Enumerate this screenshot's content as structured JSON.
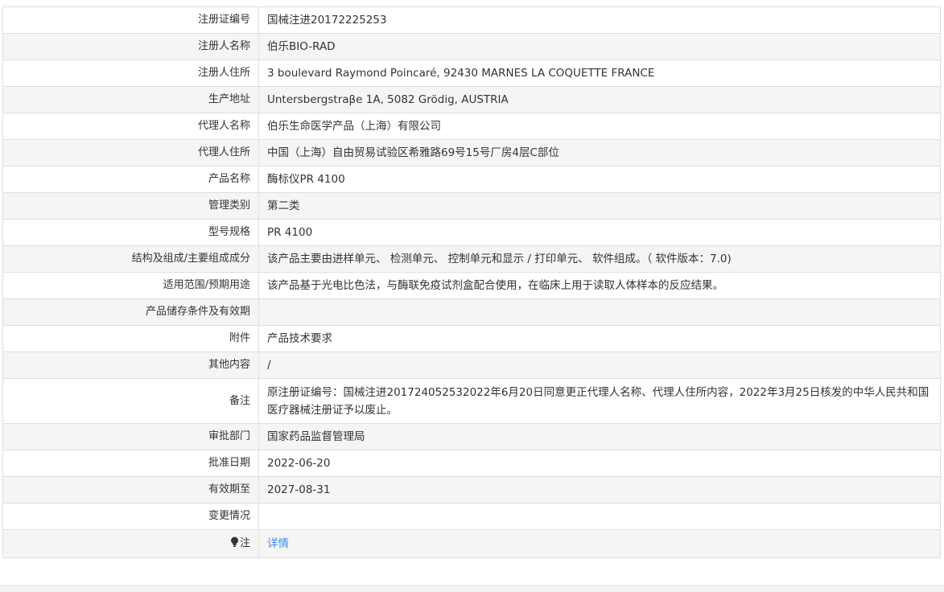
{
  "rows": [
    {
      "label": "注册证编号",
      "value": "国械注进20172225253"
    },
    {
      "label": "注册人名称",
      "value": "伯乐BIO-RAD"
    },
    {
      "label": "注册人住所",
      "value": "3 boulevard Raymond Poincaré, 92430 MARNES LA COQUETTE FRANCE"
    },
    {
      "label": "生产地址",
      "value": "Untersbergstraβe 1A, 5082 Grödig, AUSTRIA"
    },
    {
      "label": "代理人名称",
      "value": "伯乐生命医学产品（上海）有限公司"
    },
    {
      "label": "代理人住所",
      "value": "中国（上海）自由贸易试验区希雅路69号15号厂房4层C部位"
    },
    {
      "label": "产品名称",
      "value": "酶标仪PR 4100"
    },
    {
      "label": "管理类别",
      "value": "第二类"
    },
    {
      "label": "型号规格",
      "value": "PR 4100"
    },
    {
      "label": "结构及组成/主要组成成分",
      "value": "该产品主要由进样单元、 检测单元、 控制单元和显示 / 打印单元、 软件组成。（ 软件版本：7.0)"
    },
    {
      "label": "适用范围/预期用途",
      "value": "该产品基于光电比色法，与酶联免疫试剂盒配合使用，在临床上用于读取人体样本的反应结果。"
    },
    {
      "label": "产品储存条件及有效期",
      "value": ""
    },
    {
      "label": "附件",
      "value": "产品技术要求"
    },
    {
      "label": "其他内容",
      "value": "/"
    },
    {
      "label": "备注",
      "value": "原注册证编号：国械注进201724052532022年6月20日同意更正代理人名称、代理人住所内容，2022年3月25日核发的中华人民共和国医疗器械注册证予以废止。"
    },
    {
      "label": "审批部门",
      "value": "国家药品监督管理局"
    },
    {
      "label": "批准日期",
      "value": "2022-06-20"
    },
    {
      "label": "有效期至",
      "value": "2027-08-31"
    },
    {
      "label": "变更情况",
      "value": ""
    }
  ],
  "note_row": {
    "icon": "lightbulb-icon",
    "label": "注",
    "link_text": "详情"
  },
  "colors": {
    "border": "#dedede",
    "alt_row": "#f5f5f5",
    "link": "#3a8ee6"
  }
}
